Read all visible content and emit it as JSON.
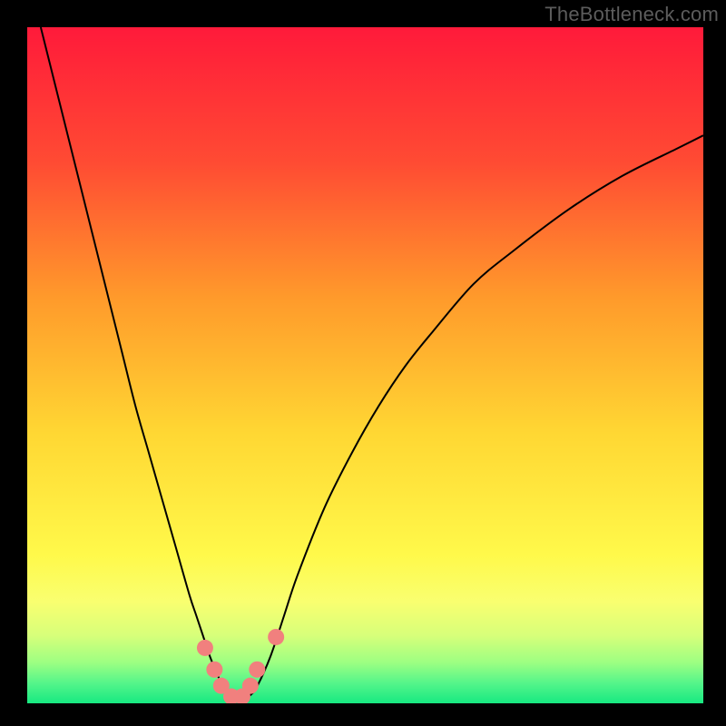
{
  "watermark": "TheBottleneck.com",
  "chart_data": {
    "type": "line",
    "title": "",
    "xlabel": "",
    "ylabel": "",
    "xlim": [
      0,
      100
    ],
    "ylim": [
      0,
      100
    ],
    "grid": false,
    "legend": false,
    "background_gradient": {
      "stops": [
        {
          "offset": 0.0,
          "color": "#ff1a3a"
        },
        {
          "offset": 0.2,
          "color": "#ff4b33"
        },
        {
          "offset": 0.4,
          "color": "#ff9a2b"
        },
        {
          "offset": 0.6,
          "color": "#ffd733"
        },
        {
          "offset": 0.78,
          "color": "#fff94a"
        },
        {
          "offset": 0.85,
          "color": "#f9ff70"
        },
        {
          "offset": 0.9,
          "color": "#d7ff7a"
        },
        {
          "offset": 0.94,
          "color": "#9cff82"
        },
        {
          "offset": 0.97,
          "color": "#55f58a"
        },
        {
          "offset": 1.0,
          "color": "#17e981"
        }
      ]
    },
    "series": [
      {
        "name": "bottleneck-curve",
        "color": "#000000",
        "x": [
          2,
          4,
          6,
          8,
          10,
          12,
          14,
          16,
          18,
          20,
          22,
          24,
          25,
          26,
          27,
          28,
          29,
          30,
          31,
          32,
          33,
          34,
          36,
          38,
          40,
          44,
          48,
          52,
          56,
          60,
          66,
          72,
          80,
          88,
          96,
          100
        ],
        "y": [
          100,
          92,
          84,
          76,
          68,
          60,
          52,
          44,
          37,
          30,
          23,
          16,
          13,
          10,
          7,
          4.5,
          2.5,
          1.2,
          0.6,
          0.6,
          1.2,
          2.5,
          7,
          13,
          19,
          29,
          37,
          44,
          50,
          55,
          62,
          67,
          73,
          78,
          82,
          84
        ]
      }
    ],
    "markers": {
      "name": "highlight-dots",
      "color": "#f1807e",
      "radius": 9,
      "points": [
        {
          "x": 26.3,
          "y": 8.2
        },
        {
          "x": 27.7,
          "y": 5.0
        },
        {
          "x": 28.7,
          "y": 2.6
        },
        {
          "x": 30.2,
          "y": 1.0
        },
        {
          "x": 31.8,
          "y": 1.0
        },
        {
          "x": 33.0,
          "y": 2.6
        },
        {
          "x": 34.0,
          "y": 5.0
        },
        {
          "x": 36.8,
          "y": 9.8
        }
      ]
    }
  }
}
